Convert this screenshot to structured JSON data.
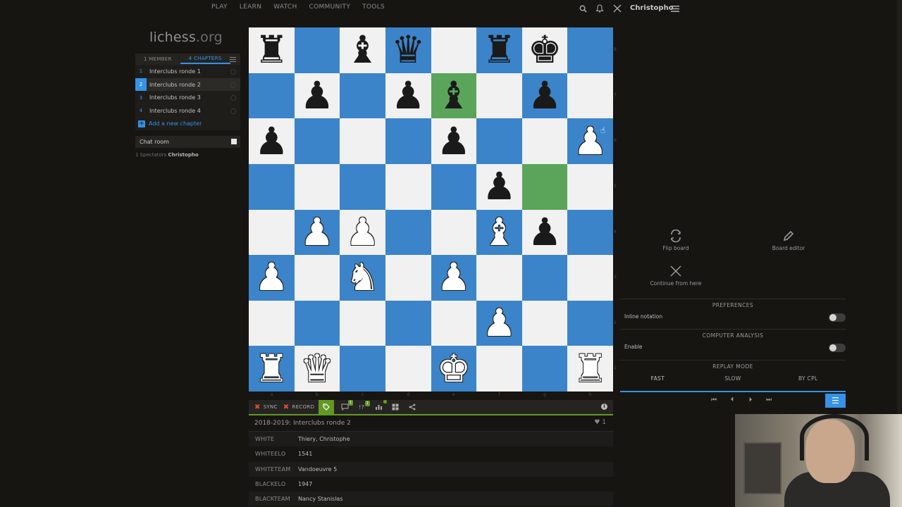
{
  "nav": {
    "items": [
      "PLAY",
      "LEARN",
      "WATCH",
      "COMMUNITY",
      "TOOLS"
    ],
    "username": "Christopho"
  },
  "site": {
    "logo_main": "lichess",
    "logo_tld": ".org"
  },
  "study": {
    "tabs": {
      "members": "1 MEMBER",
      "chapters": "4 CHAPTERS"
    },
    "chapters": [
      {
        "num": "1",
        "name": "Interclubs ronde 1",
        "active": false
      },
      {
        "num": "2",
        "name": "Interclubs ronde 2",
        "active": true
      },
      {
        "num": "3",
        "name": "Interclubs ronde 3",
        "active": false
      },
      {
        "num": "4",
        "name": "Interclubs ronde 4",
        "active": false
      }
    ],
    "add_chapter": "Add a new chapter",
    "chat_room": "Chat room",
    "spectators_prefix": "1 Spectators",
    "spectator_name": "Christopho"
  },
  "board": {
    "files": [
      "a",
      "b",
      "c",
      "d",
      "e",
      "f",
      "g",
      "h"
    ],
    "ranks": [
      "8",
      "7",
      "6",
      "5",
      "4",
      "3",
      "2",
      "1"
    ],
    "highlights": [
      "e7",
      "g5"
    ],
    "position": [
      [
        "r",
        "",
        "b",
        "q",
        "",
        "r",
        "k",
        ""
      ],
      [
        "",
        "p",
        "",
        "p",
        "b",
        "",
        "p",
        ""
      ],
      [
        "p",
        "",
        "",
        "",
        "p",
        "",
        "",
        "P"
      ],
      [
        "",
        "",
        "",
        "",
        "",
        "p",
        "",
        ""
      ],
      [
        "",
        "P",
        "P",
        "",
        "",
        "B",
        "p",
        ""
      ],
      [
        "P",
        "",
        "N",
        "",
        "P",
        "",
        "",
        ""
      ],
      [
        "",
        "",
        "",
        "",
        "",
        "P",
        "",
        ""
      ],
      [
        "R",
        "Q",
        "",
        "",
        "K",
        "",
        "",
        "R"
      ]
    ]
  },
  "controls": {
    "sync": "SYNC",
    "record": "RECORD",
    "comments_badge": "1",
    "glyphs_badge": "1"
  },
  "game_meta": {
    "title": "2018-2019: Interclubs ronde 2",
    "likes": "1",
    "rows": [
      {
        "key": "WHITE",
        "value": "Thiery, Christophe"
      },
      {
        "key": "WHITEELO",
        "value": "1541"
      },
      {
        "key": "WHITETEAM",
        "value": "Vandoeuvre 5"
      },
      {
        "key": "BLACKELO",
        "value": "1947"
      },
      {
        "key": "BLACKTEAM",
        "value": "Nancy Stanislas"
      }
    ]
  },
  "tools": {
    "flip_board": "Flip board",
    "board_editor": "Board editor",
    "continue_from_here": "Continue from here",
    "preferences_title": "PREFERENCES",
    "inline_notation": "Inline notation",
    "computer_analysis_title": "COMPUTER ANALYSIS",
    "enable": "Enable",
    "replay_mode_title": "REPLAY MODE",
    "replay_modes": [
      "FAST",
      "SLOW",
      "BY CPL"
    ],
    "replay_selected": "FAST"
  }
}
